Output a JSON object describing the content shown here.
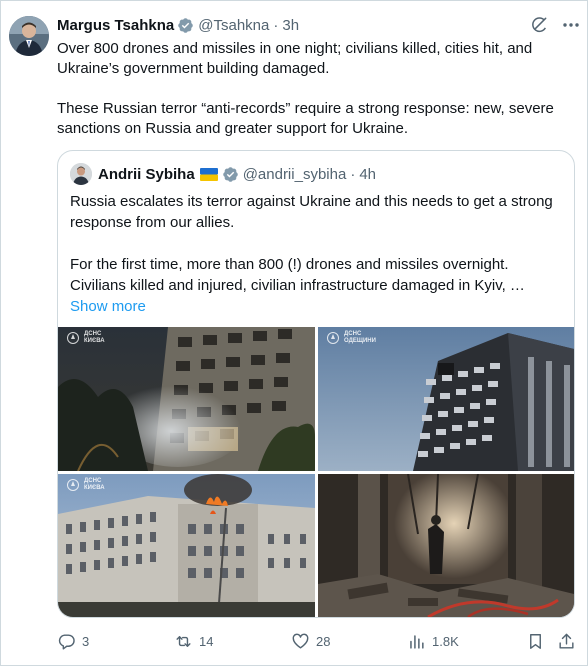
{
  "author": {
    "name": "Margus Tsahkna",
    "handle": "@Tsahkna",
    "time": "3h"
  },
  "tweet": {
    "paragraph1": "Over 800 drones and missiles in one night; civilians killed, cities hit, and Ukraine’s government building damaged.",
    "paragraph2": "These Russian terror “anti-records” require a strong response: new, severe sanctions on Russia and greater support for Ukraine."
  },
  "quote": {
    "name": "Andrii Sybiha",
    "handle": "@andrii_sybiha",
    "time": "4h",
    "paragraph1": "Russia escalates its terror against Ukraine and this needs to get a strong response from our allies.",
    "paragraph2": "For the first time, more than 800 (!) drones and missiles overnight. Civilians killed and injured, civilian infrastructure damaged in Kyiv, …",
    "show_more": "Show more",
    "watermarks": {
      "photo1": "ДСНС\nКИЄВА",
      "photo2": "ДСНС\nОДЕЩИНИ",
      "photo3": "ДСНС\nКИЄВА"
    }
  },
  "actions": {
    "replies": "3",
    "reposts": "14",
    "likes": "28",
    "views": "1.8K"
  },
  "colors": {
    "accent": "#1d9bf0",
    "text": "#0f1419",
    "muted": "#536471",
    "border": "#cfd9de",
    "verified": "#829aab"
  }
}
